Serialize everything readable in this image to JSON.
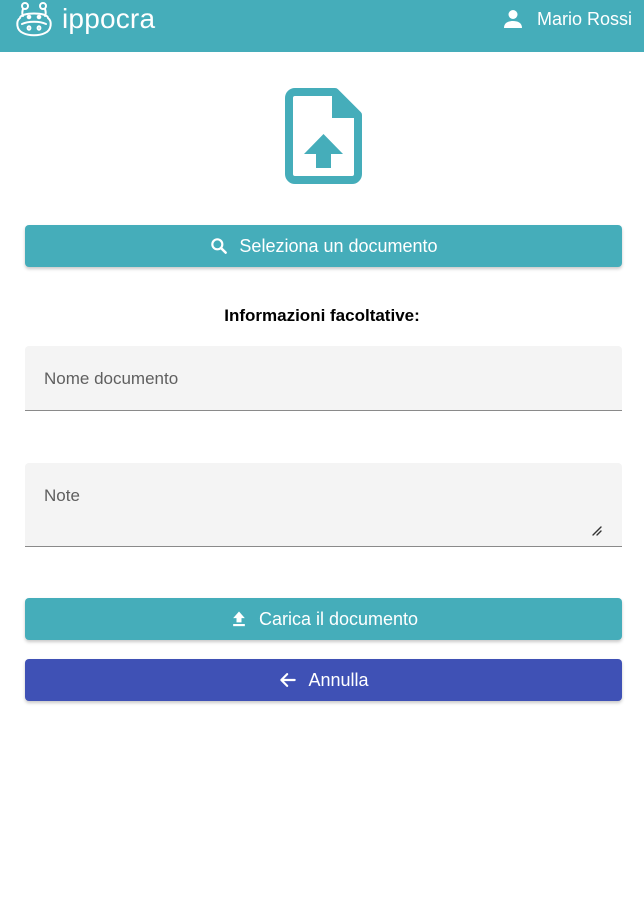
{
  "header": {
    "app_name": "ippocra",
    "user_name": "Mario Rossi",
    "logo_icon": "hippo-logo-icon",
    "user_icon": "person-icon",
    "background_color": "#45adba"
  },
  "main": {
    "document_icon": "file-upload-icon",
    "select_button": {
      "label": "Seleziona un documento",
      "icon": "search-icon"
    },
    "optional_info_title": "Informazioni facoltative:",
    "name_field": {
      "placeholder": "Nome documento",
      "value": ""
    },
    "notes_field": {
      "placeholder": "Note",
      "value": ""
    },
    "upload_button": {
      "label": "Carica il documento",
      "icon": "upload-icon"
    },
    "cancel_button": {
      "label": "Annulla",
      "icon": "arrow-left-icon"
    }
  },
  "colors": {
    "primary": "#45adba",
    "cancel": "#3f51b5"
  }
}
